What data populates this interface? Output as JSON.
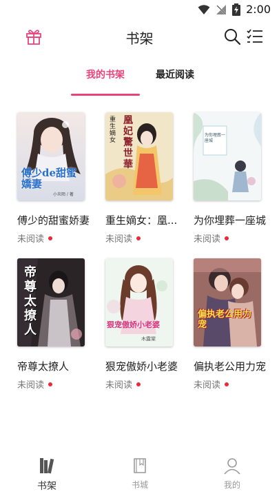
{
  "status_bar": {
    "time": "2:00"
  },
  "header": {
    "title": "书架"
  },
  "tabs": {
    "my_shelf": "我的书架",
    "recent": "最近阅读"
  },
  "books": [
    {
      "title": "傅少的甜蜜娇妻",
      "status": "未阅读",
      "cover_text": "傅少de甜蜜嬌妻",
      "cover_author": "小炎陌 / 著"
    },
    {
      "title": "重生嫡女：凰...",
      "status": "未阅读",
      "cover_text": "凰妃驚世華",
      "cover_sub": "重生嫡女"
    },
    {
      "title": "为你埋葬一座城",
      "status": "未阅读",
      "cover_text": "为你埋葬一座城"
    },
    {
      "title": "帝尊太撩人",
      "status": "未阅读",
      "cover_text": "帝尊太撩人"
    },
    {
      "title": "狠宠傲娇小老婆",
      "status": "未阅读",
      "cover_text": "狠宠傲娇小老婆",
      "cover_author": "木露棠"
    },
    {
      "title": "偏执老公用力宠",
      "status": "未阅读",
      "cover_text": "偏执老公用力宠"
    }
  ],
  "bottom_nav": {
    "shelf": "书架",
    "store": "书城",
    "mine": "我的"
  },
  "colors": {
    "accent": "#e8437a",
    "unread_dot": "#e62b3b"
  },
  "icons": {
    "gift": "gift-icon",
    "search": "search-icon",
    "menu": "list-menu-icon",
    "shelf": "bookshelf-icon",
    "store": "book-icon",
    "mine": "user-icon"
  }
}
